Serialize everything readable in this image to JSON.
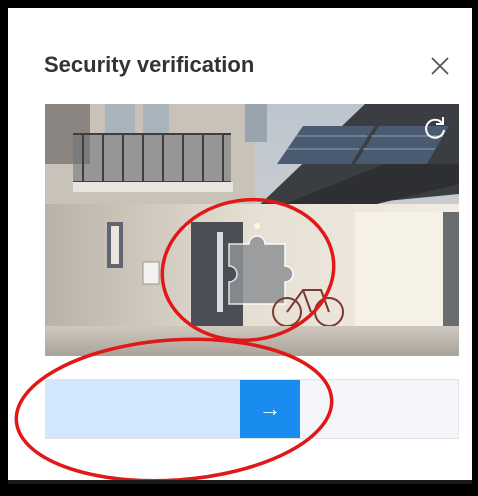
{
  "dialog": {
    "title": "Security verification",
    "close_label": "×"
  },
  "captcha": {
    "image_description_icon": "house-photo",
    "refresh_icon": "refresh-icon",
    "piece_icon": "puzzle-piece-icon"
  },
  "slider": {
    "handle_arrow": "→",
    "progress_fraction": 0.46
  },
  "colors": {
    "accent": "#1a8cf0",
    "fill": "#d3e7fc",
    "annotation": "#e01818"
  }
}
